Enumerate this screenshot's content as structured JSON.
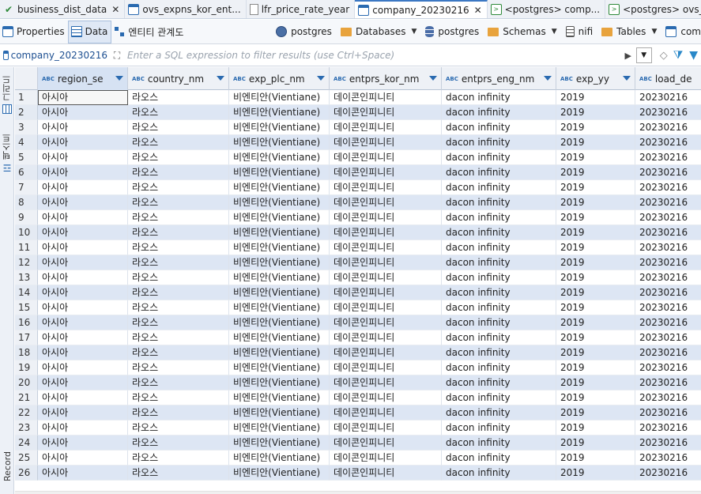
{
  "editor_tabs": [
    {
      "label": "business_dist_data",
      "icon": "check-icon",
      "closable": true,
      "active": false
    },
    {
      "label": "ovs_expns_kor_ent...",
      "icon": "table-icon",
      "closable": false,
      "active": false
    },
    {
      "label": "lfr_price_rate_year",
      "icon": "document-icon",
      "closable": false,
      "active": false
    },
    {
      "label": "company_20230216",
      "icon": "table-icon",
      "closable": true,
      "active": true
    },
    {
      "label": "<postgres> comp...",
      "icon": "sql-terminal-icon",
      "closable": false,
      "active": false
    },
    {
      "label": "<postgres> ovs_e",
      "icon": "sql-terminal-icon",
      "closable": false,
      "active": false
    }
  ],
  "sub_tabs": {
    "properties": "Properties",
    "data": "Data",
    "er_diagram": "엔티티 관계도"
  },
  "right_tools": {
    "connection": "postgres",
    "databases": "Databases",
    "database": "postgres",
    "schemas": "Schemas",
    "schema": "nifi",
    "tables": "Tables",
    "table_truncated": "com"
  },
  "filter": {
    "table_name": "company_20230216",
    "placeholder": "Enter a SQL expression to filter results (use Ctrl+Space)"
  },
  "side_panel": {
    "grid_label": "그리드",
    "text_label": "텍스트",
    "record_label": "Record"
  },
  "columns": [
    "region_se",
    "country_nm",
    "exp_plc_nm",
    "entprs_kor_nm",
    "entprs_eng_nm",
    "exp_yy",
    "load_de"
  ],
  "rows": [
    [
      "1",
      "아시아",
      "라오스",
      "비엔티안(Vientiane)",
      "데이콘인피니티",
      "dacon infinity",
      "2019",
      "20230216"
    ],
    [
      "2",
      "아시아",
      "라오스",
      "비엔티안(Vientiane)",
      "데이콘인피니티",
      "dacon infinity",
      "2019",
      "20230216"
    ],
    [
      "3",
      "아시아",
      "라오스",
      "비엔티안(Vientiane)",
      "데이콘인피니티",
      "dacon infinity",
      "2019",
      "20230216"
    ],
    [
      "4",
      "아시아",
      "라오스",
      "비엔티안(Vientiane)",
      "데이콘인피니티",
      "dacon infinity",
      "2019",
      "20230216"
    ],
    [
      "5",
      "아시아",
      "라오스",
      "비엔티안(Vientiane)",
      "데이콘인피니티",
      "dacon infinity",
      "2019",
      "20230216"
    ],
    [
      "6",
      "아시아",
      "라오스",
      "비엔티안(Vientiane)",
      "데이콘인피니티",
      "dacon infinity",
      "2019",
      "20230216"
    ],
    [
      "7",
      "아시아",
      "라오스",
      "비엔티안(Vientiane)",
      "데이콘인피니티",
      "dacon infinity",
      "2019",
      "20230216"
    ],
    [
      "8",
      "아시아",
      "라오스",
      "비엔티안(Vientiane)",
      "데이콘인피니티",
      "dacon infinity",
      "2019",
      "20230216"
    ],
    [
      "9",
      "아시아",
      "라오스",
      "비엔티안(Vientiane)",
      "데이콘인피니티",
      "dacon infinity",
      "2019",
      "20230216"
    ],
    [
      "10",
      "아시아",
      "라오스",
      "비엔티안(Vientiane)",
      "데이콘인피니티",
      "dacon infinity",
      "2019",
      "20230216"
    ],
    [
      "11",
      "아시아",
      "라오스",
      "비엔티안(Vientiane)",
      "데이콘인피니티",
      "dacon infinity",
      "2019",
      "20230216"
    ],
    [
      "12",
      "아시아",
      "라오스",
      "비엔티안(Vientiane)",
      "데이콘인피니티",
      "dacon infinity",
      "2019",
      "20230216"
    ],
    [
      "13",
      "아시아",
      "라오스",
      "비엔티안(Vientiane)",
      "데이콘인피니티",
      "dacon infinity",
      "2019",
      "20230216"
    ],
    [
      "14",
      "아시아",
      "라오스",
      "비엔티안(Vientiane)",
      "데이콘인피니티",
      "dacon infinity",
      "2019",
      "20230216"
    ],
    [
      "15",
      "아시아",
      "라오스",
      "비엔티안(Vientiane)",
      "데이콘인피니티",
      "dacon infinity",
      "2019",
      "20230216"
    ],
    [
      "16",
      "아시아",
      "라오스",
      "비엔티안(Vientiane)",
      "데이콘인피니티",
      "dacon infinity",
      "2019",
      "20230216"
    ],
    [
      "17",
      "아시아",
      "라오스",
      "비엔티안(Vientiane)",
      "데이콘인피니티",
      "dacon infinity",
      "2019",
      "20230216"
    ],
    [
      "18",
      "아시아",
      "라오스",
      "비엔티안(Vientiane)",
      "데이콘인피니티",
      "dacon infinity",
      "2019",
      "20230216"
    ],
    [
      "19",
      "아시아",
      "라오스",
      "비엔티안(Vientiane)",
      "데이콘인피니티",
      "dacon infinity",
      "2019",
      "20230216"
    ],
    [
      "20",
      "아시아",
      "라오스",
      "비엔티안(Vientiane)",
      "데이콘인피니티",
      "dacon infinity",
      "2019",
      "20230216"
    ],
    [
      "21",
      "아시아",
      "라오스",
      "비엔티안(Vientiane)",
      "데이콘인피니티",
      "dacon infinity",
      "2019",
      "20230216"
    ],
    [
      "22",
      "아시아",
      "라오스",
      "비엔티안(Vientiane)",
      "데이콘인피니티",
      "dacon infinity",
      "2019",
      "20230216"
    ],
    [
      "23",
      "아시아",
      "라오스",
      "비엔티안(Vientiane)",
      "데이콘인피니티",
      "dacon infinity",
      "2019",
      "20230216"
    ],
    [
      "24",
      "아시아",
      "라오스",
      "비엔티안(Vientiane)",
      "데이콘인피니티",
      "dacon infinity",
      "2019",
      "20230216"
    ],
    [
      "25",
      "아시아",
      "라오스",
      "비엔티안(Vientiane)",
      "데이콘인피니티",
      "dacon infinity",
      "2019",
      "20230216"
    ],
    [
      "26",
      "아시아",
      "라오스",
      "비엔티안(Vientiane)",
      "데이콘인피니티",
      "dacon infinity",
      "2019",
      "20230216"
    ]
  ],
  "colors": {
    "accent": "#2a6ab0",
    "row_alt": "#dde6f4",
    "header_bg": "#eef1f6"
  }
}
